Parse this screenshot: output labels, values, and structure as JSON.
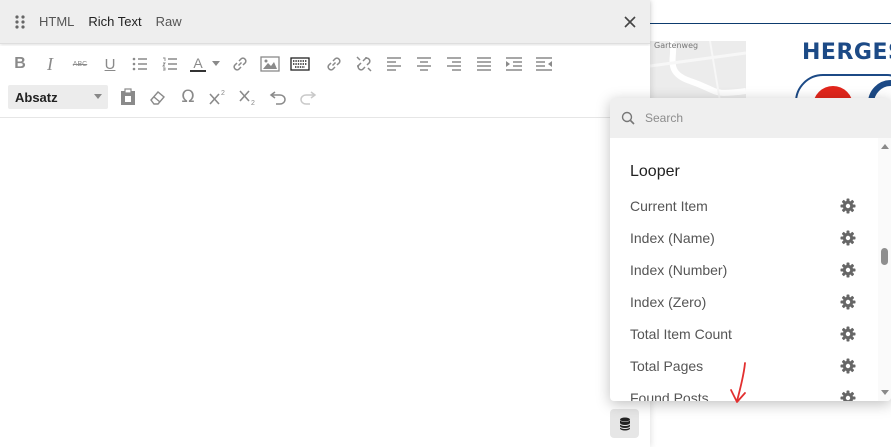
{
  "background": {
    "map_label": "Gartenweg",
    "logo_text": "HERGES",
    "brand_color": "#1c4a86",
    "logo_accent_color": "#e1261c"
  },
  "editor": {
    "tabs": [
      {
        "label": "HTML",
        "active": false
      },
      {
        "label": "Rich Text",
        "active": true
      },
      {
        "label": "Raw",
        "active": false
      }
    ],
    "toolbar": {
      "row1_icons": [
        "bold-icon",
        "italic-icon",
        "strikethrough-icon",
        "underline-icon",
        "bullet-list-icon",
        "numbered-list-icon",
        "text-color-icon",
        "text-color-caret-icon",
        "link-icon",
        "image-icon",
        "keyboard-icon",
        "link-2-icon",
        "unlink-icon",
        "align-left-icon",
        "align-center-icon",
        "align-right-icon",
        "align-justify-icon",
        "indent-icon",
        "outdent-icon"
      ],
      "format_select_value": "Absatz",
      "row2_icons": [
        "paste-icon",
        "eraser-icon",
        "omega-icon",
        "superscript-icon",
        "subscript-icon",
        "undo-icon",
        "redo-icon"
      ],
      "bold_glyph": "B",
      "italic_glyph": "I",
      "underline_glyph": "U",
      "textcolor_glyph": "A",
      "strike_glyph": "ABC",
      "omega_glyph": "Ω"
    }
  },
  "dynamic_content": {
    "search_placeholder": "Search",
    "group_title": "Looper",
    "items": [
      {
        "label": "Current Item"
      },
      {
        "label": "Index (Name)"
      },
      {
        "label": "Index (Number)"
      },
      {
        "label": "Index (Zero)"
      },
      {
        "label": "Total Item Count"
      },
      {
        "label": "Total Pages"
      },
      {
        "label": "Found Posts"
      }
    ],
    "annotation_color": "#e23030"
  }
}
